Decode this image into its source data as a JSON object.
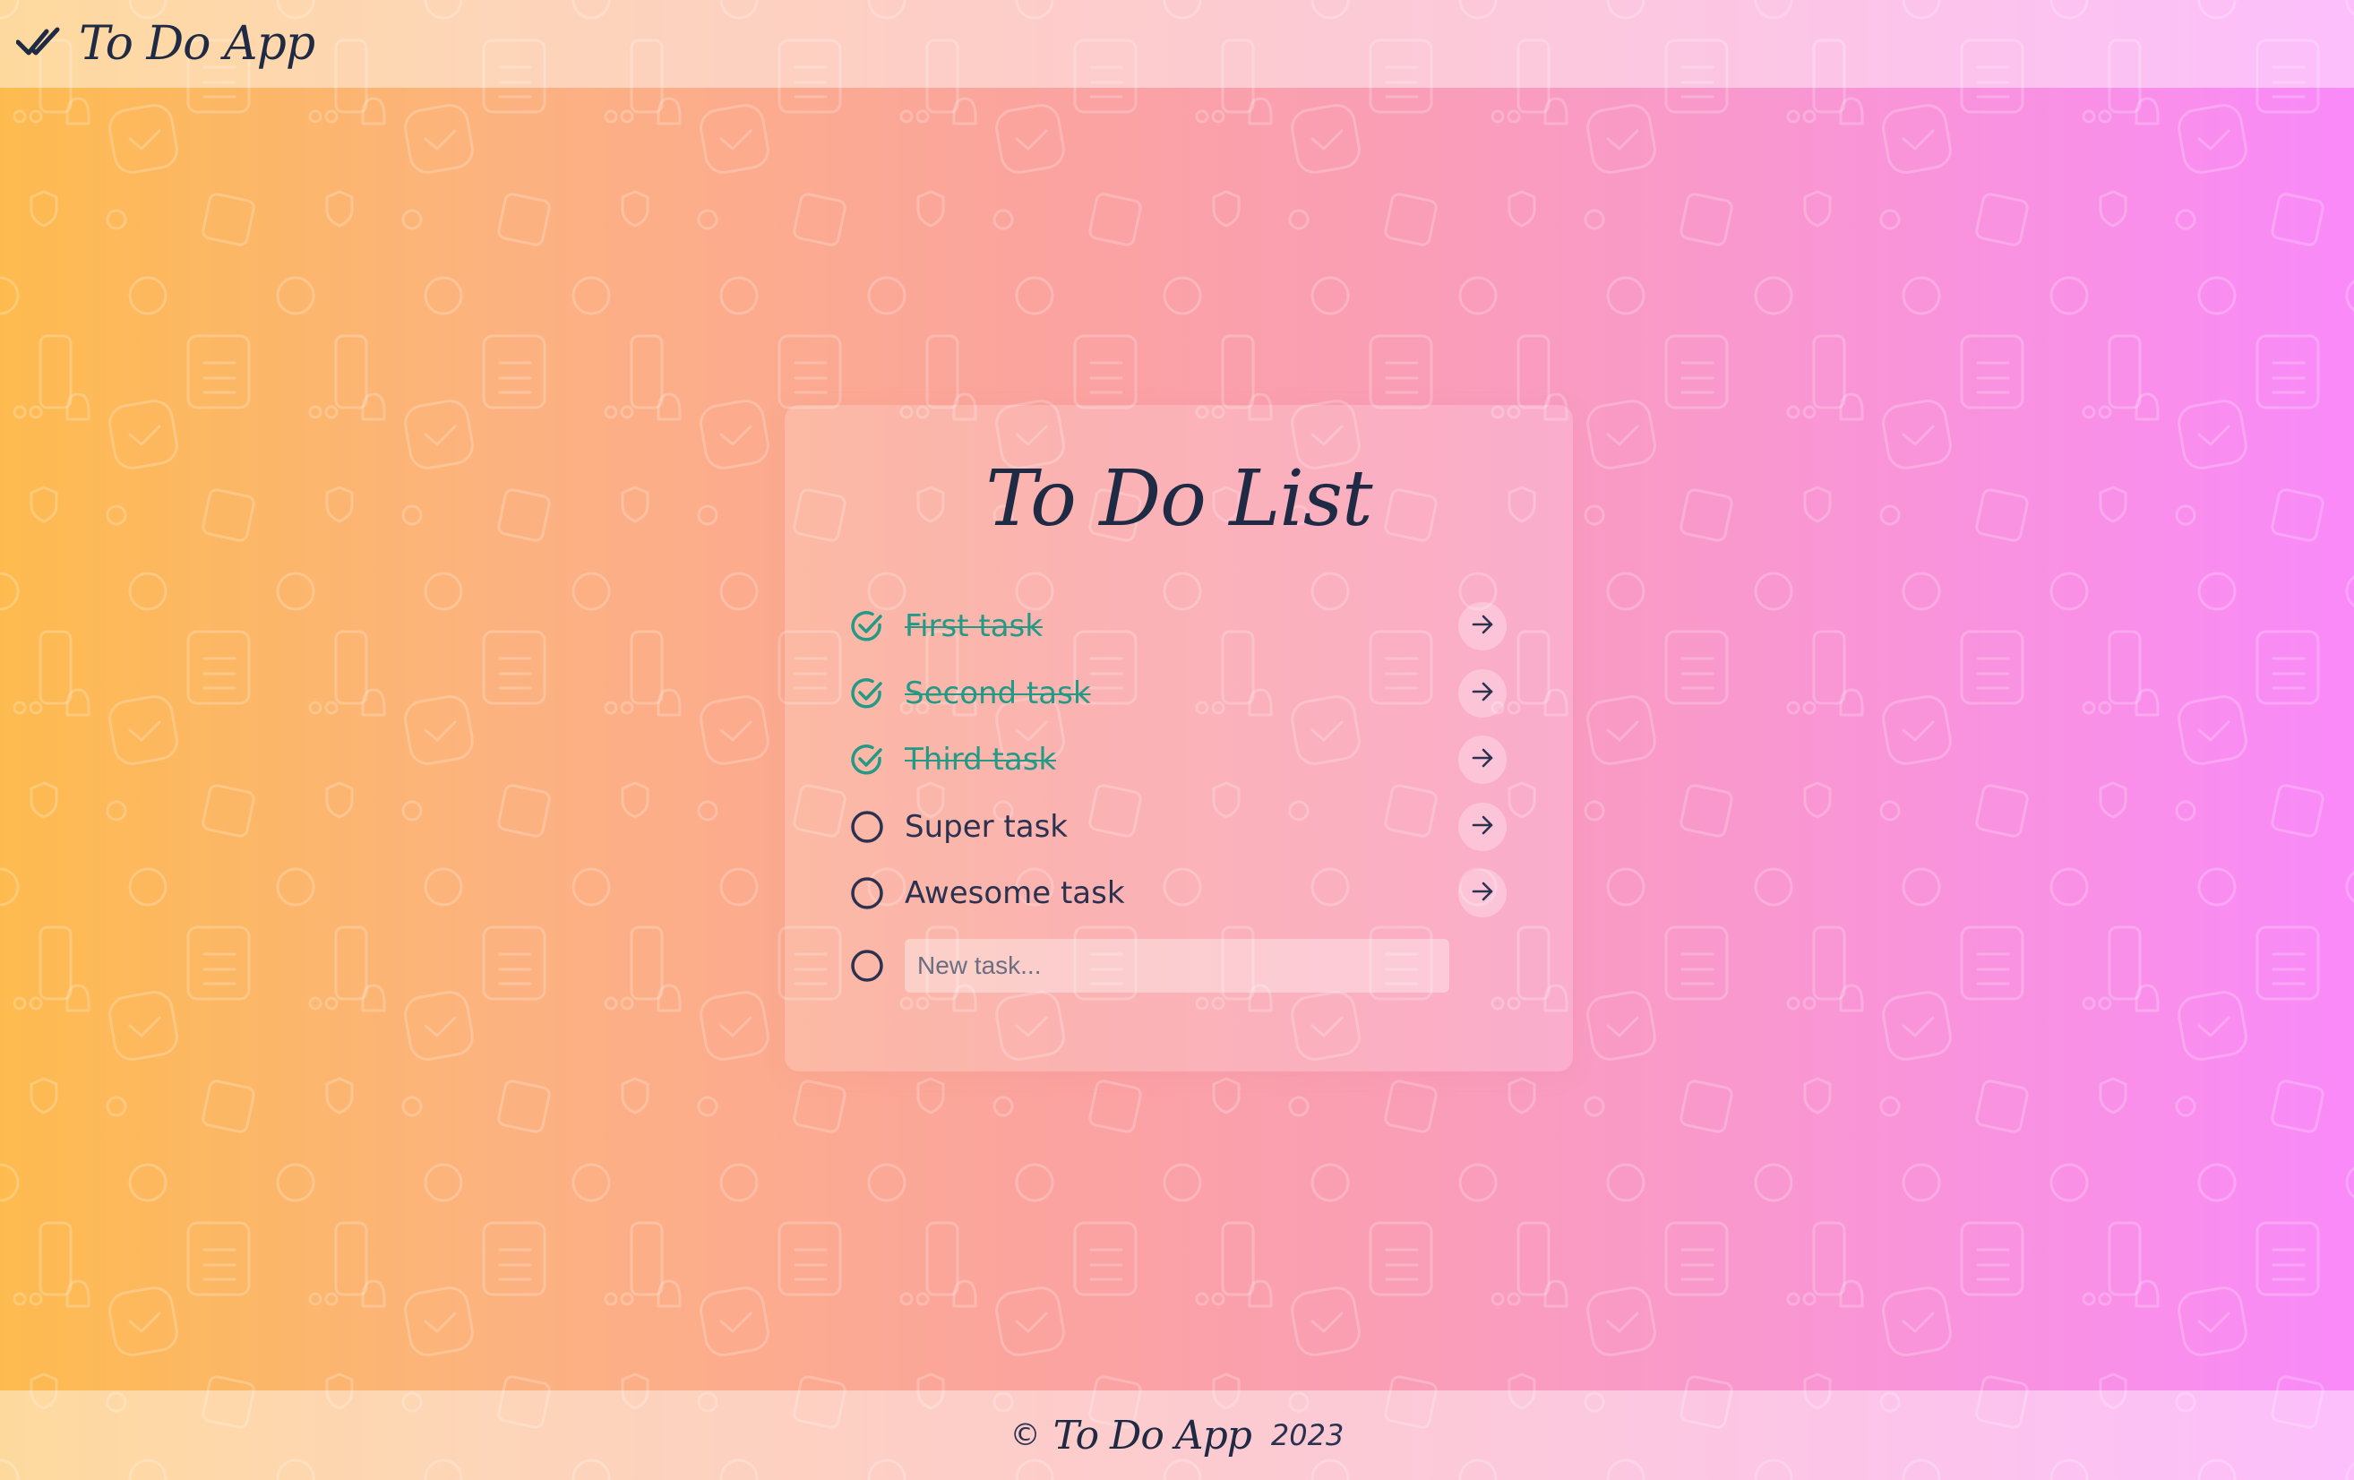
{
  "app": {
    "brand_name": "To Do App",
    "brand_icon": "double-check-icon"
  },
  "card": {
    "title": "To Do List",
    "tasks": [
      {
        "label": "First task",
        "done": true
      },
      {
        "label": "Second task",
        "done": true
      },
      {
        "label": "Third task",
        "done": true
      },
      {
        "label": "Super task",
        "done": false
      },
      {
        "label": "Awesome task",
        "done": false
      }
    ],
    "new_task": {
      "placeholder": "New task...",
      "value": ""
    }
  },
  "footer": {
    "copyright_symbol": "©",
    "name": "To Do App",
    "year": "2023"
  },
  "colors": {
    "done_teal": "#239a86",
    "text_dark": "#2a3250",
    "gradient_start": "#fdbb4f",
    "gradient_end": "#f98af9"
  }
}
